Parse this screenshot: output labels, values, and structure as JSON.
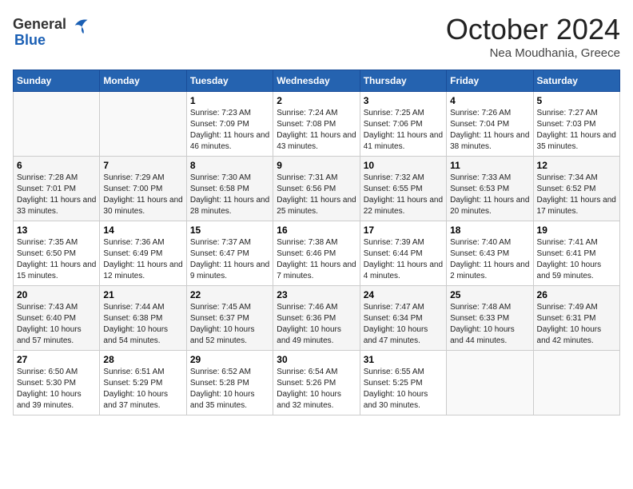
{
  "header": {
    "logo_general": "General",
    "logo_blue": "Blue",
    "month": "October 2024",
    "location": "Nea Moudhania, Greece"
  },
  "days_of_week": [
    "Sunday",
    "Monday",
    "Tuesday",
    "Wednesday",
    "Thursday",
    "Friday",
    "Saturday"
  ],
  "weeks": [
    [
      {
        "day": "",
        "info": ""
      },
      {
        "day": "",
        "info": ""
      },
      {
        "day": "1",
        "info": "Sunrise: 7:23 AM\nSunset: 7:09 PM\nDaylight: 11 hours and 46 minutes."
      },
      {
        "day": "2",
        "info": "Sunrise: 7:24 AM\nSunset: 7:08 PM\nDaylight: 11 hours and 43 minutes."
      },
      {
        "day": "3",
        "info": "Sunrise: 7:25 AM\nSunset: 7:06 PM\nDaylight: 11 hours and 41 minutes."
      },
      {
        "day": "4",
        "info": "Sunrise: 7:26 AM\nSunset: 7:04 PM\nDaylight: 11 hours and 38 minutes."
      },
      {
        "day": "5",
        "info": "Sunrise: 7:27 AM\nSunset: 7:03 PM\nDaylight: 11 hours and 35 minutes."
      }
    ],
    [
      {
        "day": "6",
        "info": "Sunrise: 7:28 AM\nSunset: 7:01 PM\nDaylight: 11 hours and 33 minutes."
      },
      {
        "day": "7",
        "info": "Sunrise: 7:29 AM\nSunset: 7:00 PM\nDaylight: 11 hours and 30 minutes."
      },
      {
        "day": "8",
        "info": "Sunrise: 7:30 AM\nSunset: 6:58 PM\nDaylight: 11 hours and 28 minutes."
      },
      {
        "day": "9",
        "info": "Sunrise: 7:31 AM\nSunset: 6:56 PM\nDaylight: 11 hours and 25 minutes."
      },
      {
        "day": "10",
        "info": "Sunrise: 7:32 AM\nSunset: 6:55 PM\nDaylight: 11 hours and 22 minutes."
      },
      {
        "day": "11",
        "info": "Sunrise: 7:33 AM\nSunset: 6:53 PM\nDaylight: 11 hours and 20 minutes."
      },
      {
        "day": "12",
        "info": "Sunrise: 7:34 AM\nSunset: 6:52 PM\nDaylight: 11 hours and 17 minutes."
      }
    ],
    [
      {
        "day": "13",
        "info": "Sunrise: 7:35 AM\nSunset: 6:50 PM\nDaylight: 11 hours and 15 minutes."
      },
      {
        "day": "14",
        "info": "Sunrise: 7:36 AM\nSunset: 6:49 PM\nDaylight: 11 hours and 12 minutes."
      },
      {
        "day": "15",
        "info": "Sunrise: 7:37 AM\nSunset: 6:47 PM\nDaylight: 11 hours and 9 minutes."
      },
      {
        "day": "16",
        "info": "Sunrise: 7:38 AM\nSunset: 6:46 PM\nDaylight: 11 hours and 7 minutes."
      },
      {
        "day": "17",
        "info": "Sunrise: 7:39 AM\nSunset: 6:44 PM\nDaylight: 11 hours and 4 minutes."
      },
      {
        "day": "18",
        "info": "Sunrise: 7:40 AM\nSunset: 6:43 PM\nDaylight: 11 hours and 2 minutes."
      },
      {
        "day": "19",
        "info": "Sunrise: 7:41 AM\nSunset: 6:41 PM\nDaylight: 10 hours and 59 minutes."
      }
    ],
    [
      {
        "day": "20",
        "info": "Sunrise: 7:43 AM\nSunset: 6:40 PM\nDaylight: 10 hours and 57 minutes."
      },
      {
        "day": "21",
        "info": "Sunrise: 7:44 AM\nSunset: 6:38 PM\nDaylight: 10 hours and 54 minutes."
      },
      {
        "day": "22",
        "info": "Sunrise: 7:45 AM\nSunset: 6:37 PM\nDaylight: 10 hours and 52 minutes."
      },
      {
        "day": "23",
        "info": "Sunrise: 7:46 AM\nSunset: 6:36 PM\nDaylight: 10 hours and 49 minutes."
      },
      {
        "day": "24",
        "info": "Sunrise: 7:47 AM\nSunset: 6:34 PM\nDaylight: 10 hours and 47 minutes."
      },
      {
        "day": "25",
        "info": "Sunrise: 7:48 AM\nSunset: 6:33 PM\nDaylight: 10 hours and 44 minutes."
      },
      {
        "day": "26",
        "info": "Sunrise: 7:49 AM\nSunset: 6:31 PM\nDaylight: 10 hours and 42 minutes."
      }
    ],
    [
      {
        "day": "27",
        "info": "Sunrise: 6:50 AM\nSunset: 5:30 PM\nDaylight: 10 hours and 39 minutes."
      },
      {
        "day": "28",
        "info": "Sunrise: 6:51 AM\nSunset: 5:29 PM\nDaylight: 10 hours and 37 minutes."
      },
      {
        "day": "29",
        "info": "Sunrise: 6:52 AM\nSunset: 5:28 PM\nDaylight: 10 hours and 35 minutes."
      },
      {
        "day": "30",
        "info": "Sunrise: 6:54 AM\nSunset: 5:26 PM\nDaylight: 10 hours and 32 minutes."
      },
      {
        "day": "31",
        "info": "Sunrise: 6:55 AM\nSunset: 5:25 PM\nDaylight: 10 hours and 30 minutes."
      },
      {
        "day": "",
        "info": ""
      },
      {
        "day": "",
        "info": ""
      }
    ]
  ]
}
